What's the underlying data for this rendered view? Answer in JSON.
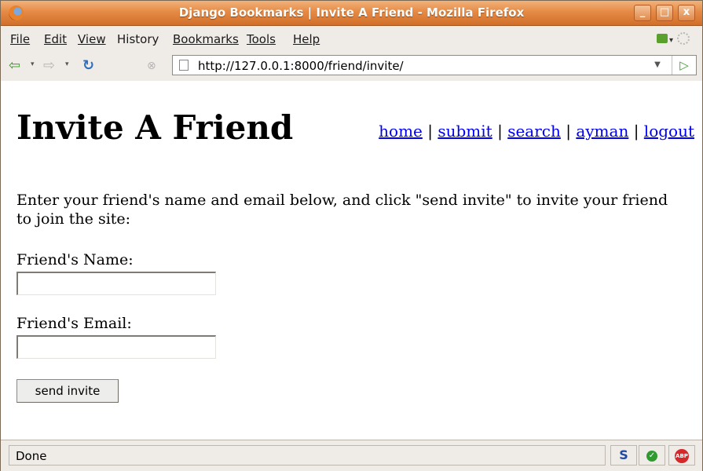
{
  "window": {
    "title": "Django Bookmarks | Invite A Friend - Mozilla Firefox",
    "buttons": {
      "minimize": "_",
      "maximize": "□",
      "close": "x"
    }
  },
  "menubar": {
    "items": [
      {
        "label": "File"
      },
      {
        "label": "Edit"
      },
      {
        "label": "View"
      },
      {
        "label": "History"
      },
      {
        "label": "Bookmarks"
      },
      {
        "label": "Tools"
      },
      {
        "label": "Help"
      }
    ]
  },
  "navbar": {
    "back_icon": "back-arrow-icon",
    "forward_icon": "forward-arrow-icon",
    "reload_icon": "reload-icon",
    "stop_icon": "stop-icon",
    "url": "http://127.0.0.1:8000/friend/invite/",
    "go_icon": "go-arrow-icon"
  },
  "page": {
    "title": "Invite A Friend",
    "nav_links": [
      "home",
      "submit",
      "search",
      "ayman",
      "logout"
    ],
    "separator": "|",
    "intro": "Enter your friend's name and email below, and click \"send invite\" to invite your friend to join the site:",
    "name_label": "Friend's Name:",
    "name_value": "",
    "email_label": "Friend's Email:",
    "email_value": "",
    "submit_label": "send invite"
  },
  "statusbar": {
    "text": "Done",
    "icons": [
      "s-icon",
      "check-icon",
      "adblock-icon"
    ]
  },
  "colors": {
    "titlebar": "#e58a45",
    "link": "#0000ee",
    "chrome": "#efebe7"
  }
}
